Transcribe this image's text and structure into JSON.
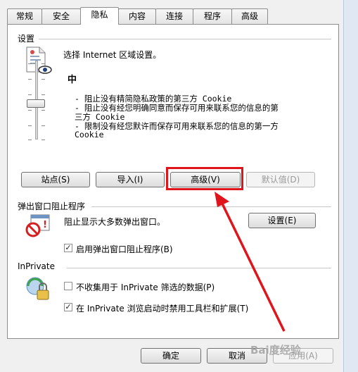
{
  "tabs": [
    "常规",
    "安全",
    "隐私",
    "内容",
    "连接",
    "程序",
    "高级"
  ],
  "settings": {
    "section_title": "设置",
    "zone_text": "选择 Internet 区域设置。",
    "level": "中",
    "lines": [
      "- 阻止没有精简隐私政策的第三方 Cookie",
      "- 阻止没有经您明确同意而保存可用来联系您的信息的第",
      "三方 Cookie",
      "- 限制没有经您默许而保存可用来联系您的信息的第一方",
      "Cookie"
    ],
    "buttons": {
      "sites": "站点(S)",
      "import": "导入(I)",
      "advanced": "高级(V)",
      "default": "默认值(D)"
    }
  },
  "popup": {
    "section_title": "弹出窗口阻止程序",
    "description": "阻止显示大多数弹出窗口。",
    "settings_button": "设置(E)",
    "enable_checkbox": {
      "label": "启用弹出窗口阻止程序(B)",
      "checked": true
    }
  },
  "inprivate": {
    "section_title": "InPrivate",
    "filter_checkbox": {
      "label": "不收集用于 InPrivate 筛选的数据(P)",
      "checked": false
    },
    "toolbar_checkbox": {
      "label": "在 InPrivate 浏览启动时禁用工具栏和扩展(T)",
      "checked": true
    }
  },
  "footer": {
    "ok": "确定",
    "cancel": "取消",
    "apply": "应用(A)"
  },
  "watermark": "Bai度经验",
  "colors": {
    "annotation_red": "#e0141b"
  }
}
